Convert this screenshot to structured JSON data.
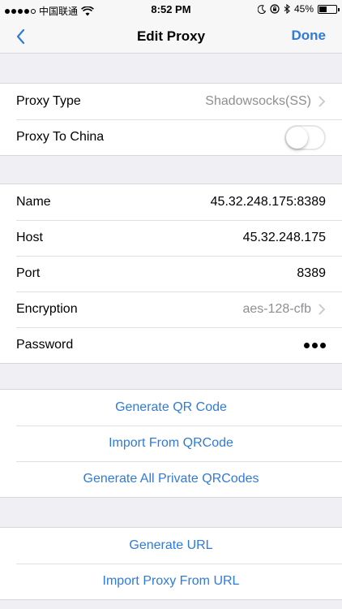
{
  "status_bar": {
    "carrier": "中国联通",
    "time": "8:52 PM",
    "battery_percent": "45%",
    "battery_level": 0.45
  },
  "nav": {
    "title": "Edit Proxy",
    "done_label": "Done",
    "back_icon": "chevron-left-icon"
  },
  "colors": {
    "accent": "#2f7bd9",
    "background": "#efeff4",
    "muted": "#8e8e93"
  },
  "proxy_group": {
    "proxy_type_label": "Proxy Type",
    "proxy_type_value": "Shadowsocks(SS)",
    "proxy_to_china_label": "Proxy To China",
    "proxy_to_china_enabled": false
  },
  "details_group": {
    "name_label": "Name",
    "name_value": "45.32.248.175:8389",
    "host_label": "Host",
    "host_value": "45.32.248.175",
    "port_label": "Port",
    "port_value": "8389",
    "encryption_label": "Encryption",
    "encryption_value": "aes-128-cfb",
    "password_label": "Password"
  },
  "qr_group": {
    "generate_qr": "Generate QR Code",
    "import_qr": "Import From QRCode",
    "generate_all_qr": "Generate All Private QRCodes"
  },
  "url_group": {
    "generate_url": "Generate URL",
    "import_url": "Import Proxy From URL"
  }
}
